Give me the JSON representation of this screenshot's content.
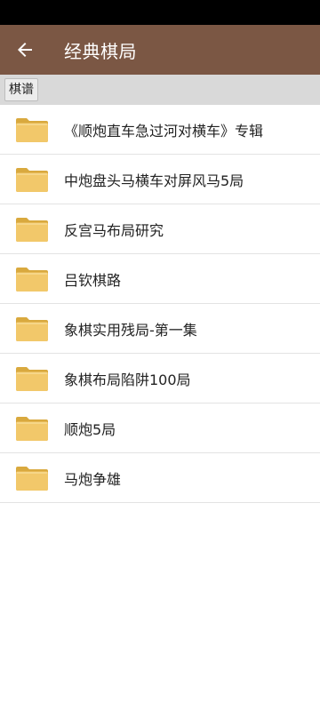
{
  "header": {
    "title": "经典棋局",
    "back_icon": "arrow-left-icon",
    "background_color": "#7b5744"
  },
  "breadcrumb": {
    "label": "棋谱"
  },
  "folder_icon": "folder-icon",
  "folder_color": "#f2c86a",
  "items": [
    {
      "label": "《顺炮直车急过河对横车》专辑"
    },
    {
      "label": "中炮盘头马横车对屏风马5局"
    },
    {
      "label": "反宫马布局研究"
    },
    {
      "label": "吕钦棋路"
    },
    {
      "label": "象棋实用残局-第一集"
    },
    {
      "label": "象棋布局陷阱100局"
    },
    {
      "label": "顺炮5局"
    },
    {
      "label": "马炮争雄"
    }
  ]
}
